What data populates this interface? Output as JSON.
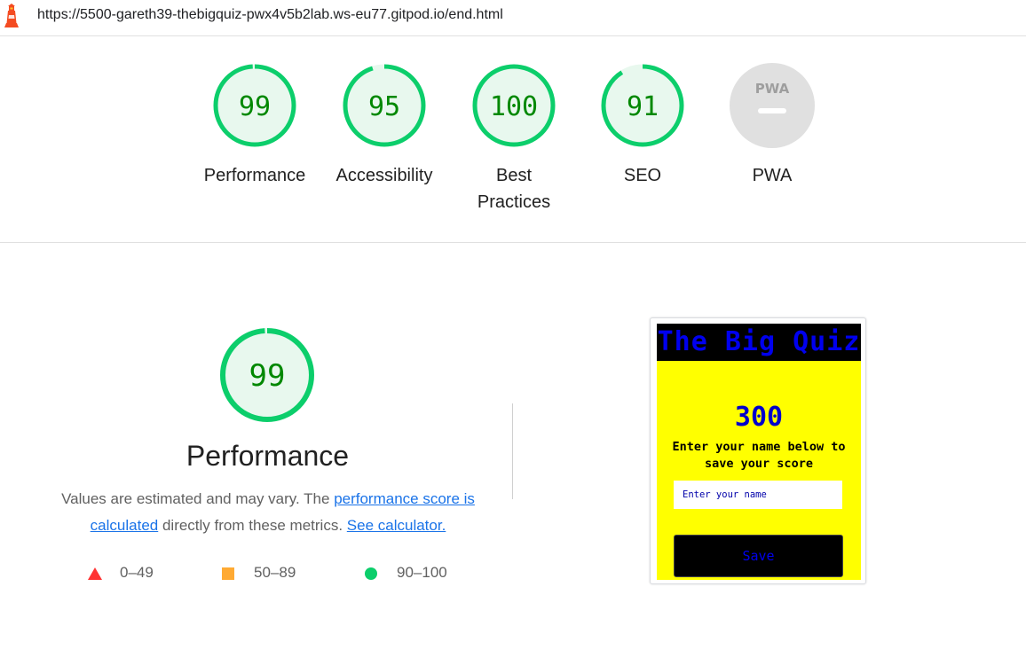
{
  "browser": {
    "url": "https://5500-gareth39-thebigquiz-pwx4v5b2lab.ws-eu77.gitpod.io/end.html",
    "logo_icon": "lighthouse-icon"
  },
  "gauges": [
    {
      "label": "Performance",
      "score": "99",
      "fraction": 0.99,
      "color": "#0cce6b"
    },
    {
      "label": "Accessibility",
      "score": "95",
      "fraction": 0.95,
      "color": "#0cce6b"
    },
    {
      "label": "Best Practices",
      "score": "100",
      "fraction": 1.0,
      "color": "#0cce6b"
    },
    {
      "label": "SEO",
      "score": "91",
      "fraction": 0.91,
      "color": "#0cce6b"
    },
    {
      "label": "PWA",
      "badge": "PWA",
      "score": null,
      "color": "#e0e0e0"
    }
  ],
  "performance": {
    "score": "99",
    "fraction": 0.99,
    "title": "Performance",
    "desc_prefix": "Values are estimated and may vary. The ",
    "link_score": "performance score is calculated",
    "desc_middle": " directly from these metrics. ",
    "link_calculator": "See calculator.",
    "legend": [
      {
        "range": "0–49",
        "shape": "triangle",
        "color": "#ff3333"
      },
      {
        "range": "50–89",
        "shape": "square",
        "color": "#ffaa33"
      },
      {
        "range": "90–100",
        "shape": "circle",
        "color": "#0cce6b"
      }
    ]
  },
  "screenshot": {
    "header": "The Big Quiz",
    "score": "300",
    "prompt": "Enter your name below to save your score",
    "input_placeholder": "Enter your name",
    "save_label": "Save"
  },
  "colors": {
    "pass_fill": "#e8f8ee",
    "pass_stroke": "#0cce6b",
    "pass_text": "#008800",
    "link": "#1a73e8"
  }
}
